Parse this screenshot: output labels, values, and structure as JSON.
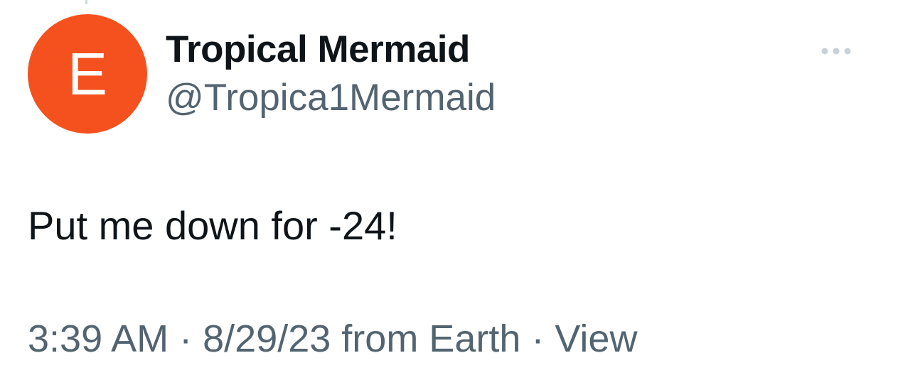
{
  "author": {
    "display_name": "Tropical Mermaid",
    "handle": "@Tropica1Mermaid",
    "avatar_letter": "E",
    "avatar_color": "#f4511e"
  },
  "tweet": {
    "text": "Put me down for -24!",
    "time": "3:39 AM",
    "separator": " · ",
    "date": "8/29/23",
    "source": " from Earth",
    "view_label": "View"
  },
  "icons": {
    "more": "more-horizontal-icon"
  }
}
